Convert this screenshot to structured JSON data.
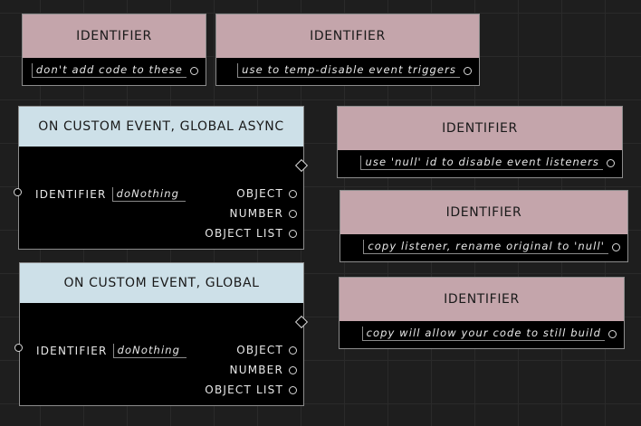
{
  "nodes": [
    {
      "header": "IDENTIFIER",
      "value": "don't add code to these"
    },
    {
      "header": "IDENTIFIER",
      "value": "use to temp-disable event triggers"
    },
    {
      "header": "IDENTIFIER",
      "value": "use 'null' id to disable event listeners"
    },
    {
      "header": "IDENTIFIER",
      "value": "copy listener, rename original to 'null'"
    },
    {
      "header": "IDENTIFIER",
      "value": "copy will allow your code to still build"
    }
  ],
  "event_nodes": [
    {
      "header": "ON CUSTOM EVENT, GLOBAL ASYNC",
      "input_label": "IDENTIFIER",
      "input_value": "doNothing",
      "outputs": [
        "OBJECT",
        "NUMBER",
        "OBJECT LIST"
      ]
    },
    {
      "header": "ON CUSTOM EVENT, GLOBAL",
      "input_label": "IDENTIFIER",
      "input_value": "doNothing",
      "outputs": [
        "OBJECT",
        "NUMBER",
        "OBJECT LIST"
      ]
    }
  ],
  "colors": {
    "canvas": "#1e1e1e",
    "identifier_header": "#c4a5ab",
    "event_header": "#cde0e8",
    "node_body": "#000000"
  }
}
